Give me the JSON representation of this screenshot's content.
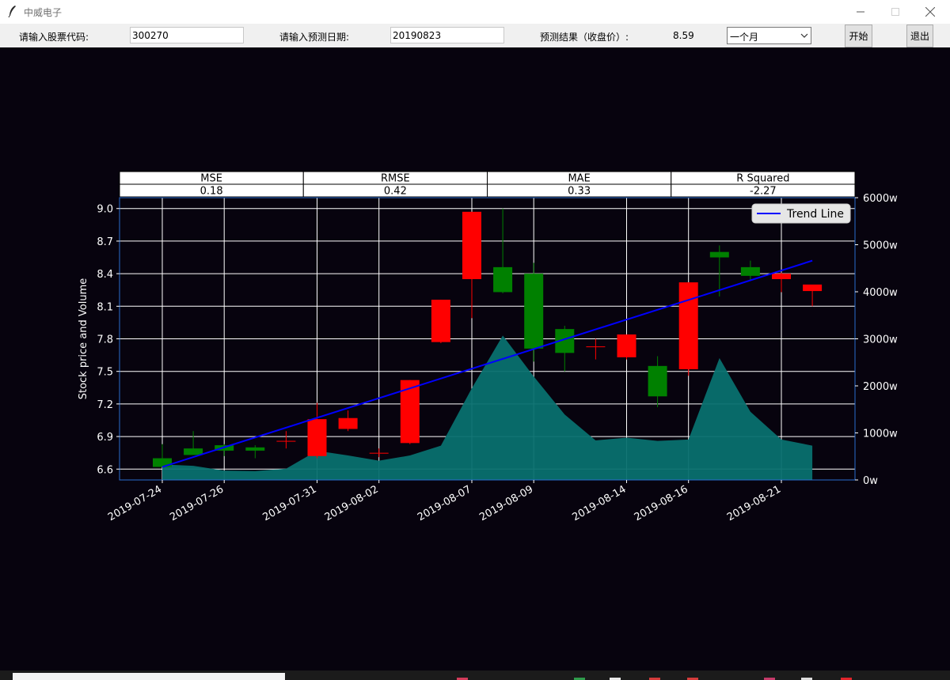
{
  "window": {
    "title": "中威电子"
  },
  "toolbar": {
    "code_label": "请输入股票代码:",
    "code_value": "300270",
    "date_label": "请输入预测日期:",
    "date_value": "20190823",
    "result_label": "预测结果（收盘价）:",
    "result_value": "8.59",
    "period_selected": "一个月",
    "start_label": "开始",
    "exit_label": "退出"
  },
  "metrics": {
    "headers": [
      "MSE",
      "RMSE",
      "MAE",
      "R Squared"
    ],
    "values": [
      "0.18",
      "0.42",
      "0.33",
      "-2.27"
    ]
  },
  "colors": {
    "up": "#ff0000",
    "down": "#008000",
    "volume": "#08706f",
    "trend": "#0000ff",
    "background": "#07030e",
    "grid": "#ffffff"
  },
  "chart_data": {
    "type": "candlestick",
    "ylabel": "Stock price and Volume",
    "ylim": [
      6.5,
      9.1
    ],
    "yticks": [
      6.6,
      6.9,
      7.2,
      7.5,
      7.8,
      8.1,
      8.4,
      8.7,
      9.0
    ],
    "ytick_labels": [
      "6.6",
      "6.9",
      "7.2",
      "7.5",
      "7.8",
      "8.1",
      "8.4",
      "8.7",
      "9.0"
    ],
    "y2lim": [
      0,
      6000
    ],
    "y2ticks": [
      0,
      1000,
      2000,
      3000,
      4000,
      5000,
      6000
    ],
    "y2tick_labels": [
      "0w",
      "1000w",
      "2000w",
      "3000w",
      "4000w",
      "5000w",
      "6000w"
    ],
    "grid": true,
    "legend": {
      "position": "top-right",
      "entries": [
        "Trend Line"
      ]
    },
    "xtick_labels": [
      "2019-07-24",
      "2019-07-26",
      "2019-07-31",
      "2019-08-02",
      "2019-08-07",
      "2019-08-09",
      "2019-08-14",
      "2019-08-16",
      "2019-08-21"
    ],
    "dates": [
      "2019-07-24",
      "2019-07-25",
      "2019-07-26",
      "2019-07-29",
      "2019-07-30",
      "2019-07-31",
      "2019-08-01",
      "2019-08-02",
      "2019-08-05",
      "2019-08-06",
      "2019-08-07",
      "2019-08-08",
      "2019-08-09",
      "2019-08-12",
      "2019-08-13",
      "2019-08-14",
      "2019-08-15",
      "2019-08-16",
      "2019-08-19",
      "2019-08-20",
      "2019-08-21",
      "2019-08-22"
    ],
    "open": [
      6.7,
      6.79,
      6.82,
      6.8,
      6.86,
      6.72,
      6.97,
      6.75,
      6.84,
      7.77,
      8.35,
      8.46,
      8.4,
      7.89,
      7.73,
      7.63,
      7.55,
      7.52,
      8.6,
      8.46,
      8.35,
      8.24
    ],
    "high": [
      6.83,
      6.95,
      6.83,
      6.82,
      6.95,
      7.21,
      7.14,
      6.79,
      7.42,
      8.16,
      8.97,
      9.0,
      8.5,
      7.92,
      7.8,
      7.84,
      7.64,
      8.32,
      8.66,
      8.52,
      8.41,
      8.29
    ],
    "low": [
      6.62,
      6.76,
      6.72,
      6.7,
      6.79,
      6.7,
      6.95,
      6.71,
      6.83,
      7.76,
      7.99,
      8.22,
      7.59,
      7.5,
      7.61,
      7.61,
      7.17,
      7.46,
      8.19,
      8.34,
      8.23,
      8.1
    ],
    "close": [
      6.62,
      6.73,
      6.77,
      6.77,
      6.86,
      7.06,
      7.07,
      6.75,
      7.42,
      8.16,
      8.97,
      8.23,
      7.71,
      7.67,
      7.73,
      7.84,
      7.27,
      8.32,
      8.55,
      8.38,
      8.4,
      8.3
    ],
    "volume": [
      330,
      300,
      200,
      190,
      240,
      620,
      520,
      410,
      520,
      730,
      1950,
      3070,
      2200,
      1390,
      840,
      900,
      830,
      860,
      2590,
      1450,
      860,
      730
    ],
    "trend_line": {
      "start": 6.62,
      "end": 8.52
    }
  }
}
